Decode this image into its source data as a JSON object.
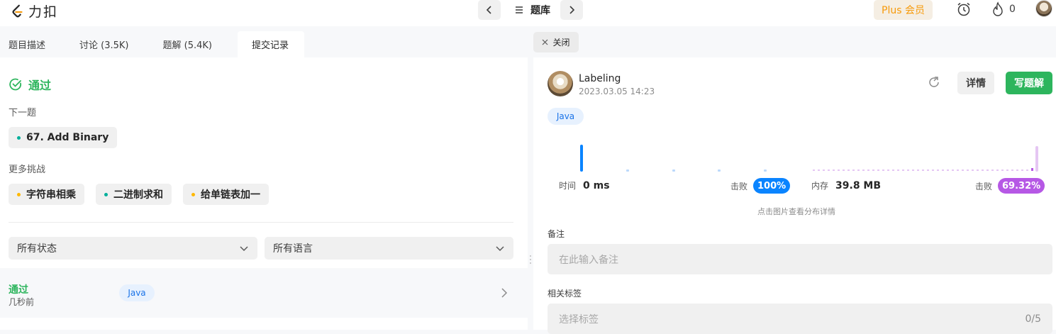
{
  "header": {
    "logo_text": "力扣",
    "problem_list_label": "题库",
    "plus_label": "Plus 会员",
    "streak_count": "0"
  },
  "left": {
    "tabs": [
      {
        "label": "题目描述"
      },
      {
        "label": "讨论 (3.5K)"
      },
      {
        "label": "题解 (5.4K)"
      },
      {
        "label": "提交记录"
      }
    ],
    "status": "通过",
    "next_label": "下一题",
    "next_problem": "67. Add Binary",
    "more_label": "更多挑战",
    "challenges": [
      "字符串相乘",
      "二进制求和",
      "给单链表加一"
    ],
    "filters": {
      "status": "所有状态",
      "language": "所有语言"
    },
    "submission": {
      "status": "通过",
      "time": "几秒前",
      "language": "Java"
    }
  },
  "right": {
    "close_label": "关闭",
    "user": {
      "name": "Labeling",
      "date": "2023.03.05 14:23"
    },
    "detail_label": "详情",
    "write_label": "写题解",
    "language": "Java",
    "runtime": {
      "label": "时间",
      "value": "0 ms",
      "beat_label": "击败",
      "beat": "100%",
      "beat_fraction": 1.0
    },
    "memory": {
      "label": "内存",
      "value": "39.8 MB",
      "beat_label": "击败",
      "beat": "69.32%",
      "beat_fraction": 0.6932
    },
    "hint": "点击图片查看分布详情",
    "note_label": "备注",
    "note_placeholder": "在此输入备注",
    "tags_label": "相关标签",
    "tags_placeholder": "选择标签",
    "tags_count": "0/5"
  },
  "colors": {
    "accent_green": "#2db55d",
    "runtime_blue": "#0a84ff",
    "memory_purple": "#b658e5",
    "plus_orange": "#f79a0a"
  }
}
